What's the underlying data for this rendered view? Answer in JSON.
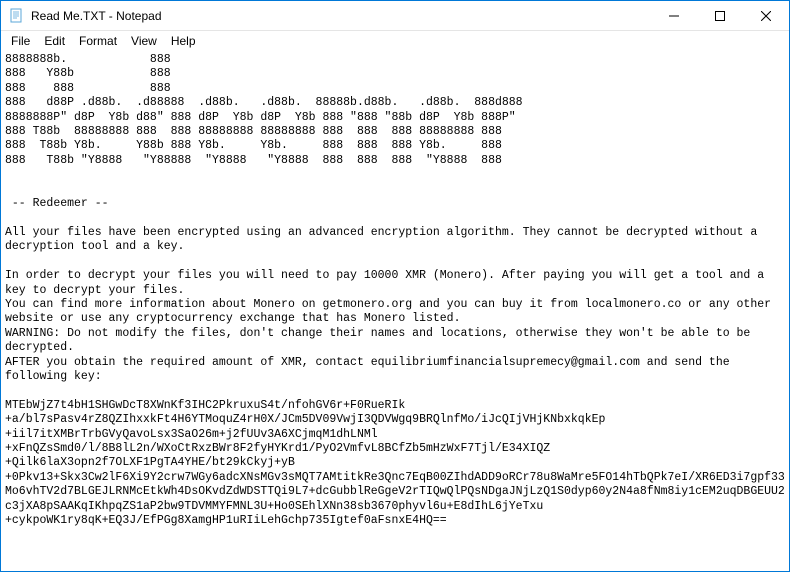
{
  "window": {
    "title": "Read Me.TXT - Notepad"
  },
  "menu": {
    "file": "File",
    "edit": "Edit",
    "format": "Format",
    "view": "View",
    "help": "Help"
  },
  "body": {
    "ascii": "8888888b.            888\n888   Y88b           888\n888    888           888\n888   d88P .d88b.  .d88888  .d88b.   .d88b.  88888b.d88b.   .d88b.  888d888\n8888888P\" d8P  Y8b d88\" 888 d8P  Y8b d8P  Y8b 888 \"888 \"88b d8P  Y8b 888P\"\n888 T88b  88888888 888  888 88888888 88888888 888  888  888 88888888 888\n888  T88b Y8b.     Y88b 888 Y8b.     Y8b.     888  888  888 Y8b.     888\n888   T88b \"Y8888   \"Y88888  \"Y8888   \"Y8888  888  888  888  \"Y8888  888",
    "header": " -- Redeemer --",
    "p1": "All your files have been encrypted using an advanced encryption algorithm. They cannot be decrypted without a decryption tool and a key.",
    "p2": "In order to decrypt your files you will need to pay 10000 XMR (Monero). After paying you will get a tool and a key to decrypt your files.",
    "p3": "You can find more information about Monero on getmonero.org and you can buy it from localmonero.co or any other website or use any cryptocurrency exchange that has Monero listed.",
    "p4": "WARNING: Do not modify the files, don't change their names and locations, otherwise they won't be able to be decrypted.",
    "p5": "AFTER you obtain the required amount of XMR, contact equilibriumfinancialsupremecy@gmail.com and send the following key:",
    "key": "MTEbWjZ7t4bH1SHGwDcT8XWnKf3IHC2PkruxuS4t/nfohGV6r+F0RueRIk\n+a/bl7sPasv4rZ8QZIhxxkFt4H6YTMoquZ4rH0X/JCm5DV09VwjI3QDVWgq9BRQlnfMo/iJcQIjVHjKNbxkqkEp\n+iil7itXMBrTrbGVyQavoLsx3SaO26m+j2fUUv3A6XCjmqM1dhLNMl\n+xFnQZsSmd0/l/8B8lL2n/WXoCtRxzBWr8F2fyHYKrd1/PyO2VmfvL8BCfZb5mHzWxF7Tjl/E34XIQZ\n+Qilk6laX3opn2f7OLXF1PgTA4YHE/bt29kCkyj+yB\n+0Pkv13+Skx3Cw2lF6Xi9Y2crw7WGy6adcXNsMGv3sMQT7AMtitkRe3Qnc7EqB00ZIhdADD9oRCr78u8WaMre5FO14hTbQPk7eI/XR6ED3i7gpf33Mo6vhTV2d7BLGEJLRNMcEtkWh4DsOKvdZdWDSTTQi9L7+dcGubblReGgeV2rTIQwQlPQsNDgaJNjLzQ1S0dyp60y2N4a8fNm8iy1cEM2uqDBGEUU2c3jXA8pSAAKqIKhpqZS1aP2bw9TDVMMYFMNL3U+Ho0SEhlXNn38sb3670phyvl6u+E8dIhL6jYeTxu\n+cykpoWK1ry8qK+EQ3J/EfPGg8XamgHP1uRIiLehGchp735Igtef0aFsnxE4HQ=="
  }
}
